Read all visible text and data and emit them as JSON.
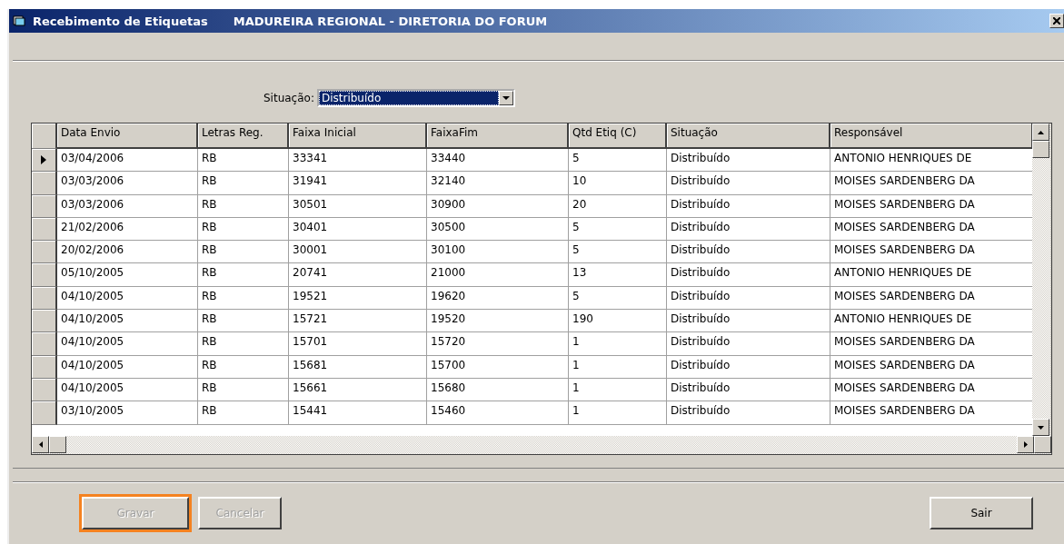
{
  "window": {
    "title": "Recebimento de Etiquetas",
    "subtitle": "MADUREIRA REGIONAL - DIRETORIA DO FORUM"
  },
  "filter": {
    "label": "Situação:",
    "value": "Distribuído"
  },
  "table": {
    "columns": [
      "Data Envio",
      "Letras Reg.",
      "Faixa Inicial",
      "FaixaFim",
      "Qtd Etiq (C)",
      "Situação",
      "Responsável"
    ],
    "rows": [
      {
        "selected": true,
        "cells": [
          "03/04/2006",
          "RB",
          "33341",
          "33440",
          "5",
          "Distribuído",
          "ANTONIO HENRIQUES DE"
        ]
      },
      {
        "selected": false,
        "cells": [
          "03/03/2006",
          "RB",
          "31941",
          "32140",
          "10",
          "Distribuído",
          "MOISES SARDENBERG DA"
        ]
      },
      {
        "selected": false,
        "cells": [
          "03/03/2006",
          "RB",
          "30501",
          "30900",
          "20",
          "Distribuído",
          "MOISES SARDENBERG DA"
        ]
      },
      {
        "selected": false,
        "cells": [
          "21/02/2006",
          "RB",
          "30401",
          "30500",
          "5",
          "Distribuído",
          "MOISES SARDENBERG DA"
        ]
      },
      {
        "selected": false,
        "cells": [
          "20/02/2006",
          "RB",
          "30001",
          "30100",
          "5",
          "Distribuído",
          "MOISES SARDENBERG DA"
        ]
      },
      {
        "selected": false,
        "cells": [
          "05/10/2005",
          "RB",
          "20741",
          "21000",
          "13",
          "Distribuído",
          "ANTONIO HENRIQUES DE"
        ]
      },
      {
        "selected": false,
        "cells": [
          "04/10/2005",
          "RB",
          "19521",
          "19620",
          "5",
          "Distribuído",
          "MOISES SARDENBERG DA"
        ]
      },
      {
        "selected": false,
        "cells": [
          "04/10/2005",
          "RB",
          "15721",
          "19520",
          "190",
          "Distribuído",
          "ANTONIO HENRIQUES DE"
        ]
      },
      {
        "selected": false,
        "cells": [
          "04/10/2005",
          "RB",
          "15701",
          "15720",
          "1",
          "Distribuído",
          "MOISES SARDENBERG DA"
        ]
      },
      {
        "selected": false,
        "cells": [
          "04/10/2005",
          "RB",
          "15681",
          "15700",
          "1",
          "Distribuído",
          "MOISES SARDENBERG DA"
        ]
      },
      {
        "selected": false,
        "cells": [
          "04/10/2005",
          "RB",
          "15661",
          "15680",
          "1",
          "Distribuído",
          "MOISES SARDENBERG DA"
        ]
      },
      {
        "selected": false,
        "cells": [
          "03/10/2005",
          "RB",
          "15441",
          "15460",
          "1",
          "Distribuído",
          "MOISES SARDENBERG DA"
        ]
      }
    ]
  },
  "buttons": [
    {
      "label": "Gravar",
      "disabled": true,
      "highlighted": true
    },
    {
      "label": "Cancelar",
      "disabled": true,
      "highlighted": false
    },
    {
      "label": "Sair",
      "disabled": false,
      "highlighted": false
    }
  ]
}
